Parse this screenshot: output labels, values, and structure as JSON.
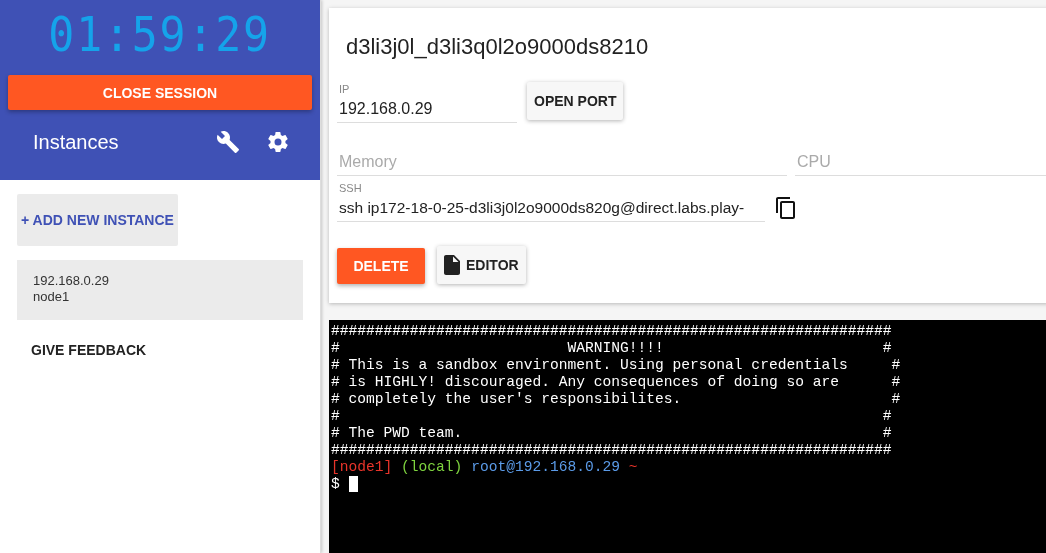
{
  "sidebar": {
    "timer": "01:59:29",
    "close_button": "CLOSE SESSION",
    "title": "Instances",
    "add_button": "+ ADD NEW INSTANCE",
    "instances": [
      {
        "ip": "192.168.0.29",
        "name": "node1",
        "selected": true
      }
    ],
    "feedback_link": "GIVE FEEDBACK"
  },
  "instance": {
    "name": "d3li3j0l_d3li3q0l2o9000ds8210",
    "ip": {
      "label": "IP",
      "value": "192.168.0.29"
    },
    "open_port_button": "OPEN PORT",
    "memory": {
      "placeholder": "Memory"
    },
    "cpu": {
      "placeholder": "CPU"
    },
    "ssh": {
      "label": "SSH",
      "value": "ssh ip172-18-0-25-d3li3j0l2o9000ds820g@direct.labs.play-"
    },
    "delete_button": "DELETE",
    "editor_button": "EDITOR"
  },
  "terminal": {
    "lines": [
      "################################################################",
      "#                          WARNING!!!!                         #",
      "# This is a sandbox environment. Using personal credentials     #",
      "# is HIGHLY! discouraged. Any consequences of doing so are      #",
      "# completely the user's responsibilites.                        #",
      "#                                                              #",
      "# The PWD team.                                                #",
      "################################################################"
    ],
    "prompt": {
      "node": "[node1]",
      "env": "(local)",
      "user_host": "root@192.168.0.29",
      "path": "~",
      "symbol": "$"
    }
  }
}
